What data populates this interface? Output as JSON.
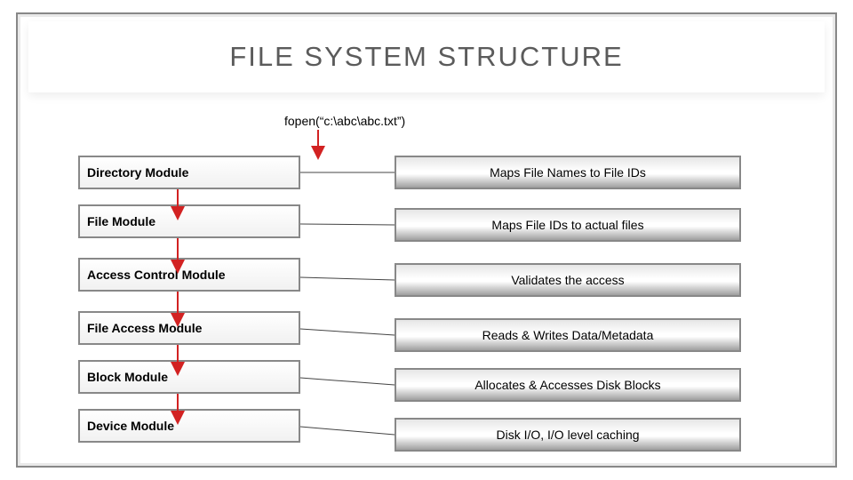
{
  "title": "FILE SYSTEM STRUCTURE",
  "fopen_call": "fopen(“c:\\abc\\abc.txt”)",
  "modules": [
    {
      "name": "Directory Module",
      "desc": "Maps File Names to File IDs"
    },
    {
      "name": "File Module",
      "desc": "Maps File IDs to actual files"
    },
    {
      "name": "Access Control Module",
      "desc": "Validates the access"
    },
    {
      "name": "File Access Module",
      "desc": "Reads & Writes Data/Metadata"
    },
    {
      "name": "Block Module",
      "desc": "Allocates & Accesses Disk Blocks"
    },
    {
      "name": "Device Module",
      "desc": "Disk I/O, I/O level caching"
    }
  ],
  "colors": {
    "arrow": "#d22222"
  }
}
